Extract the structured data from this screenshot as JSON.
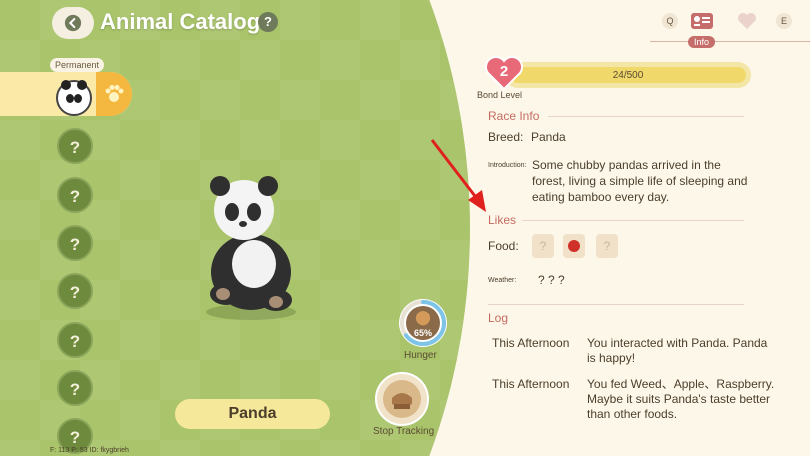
{
  "header": {
    "title": "Animal Catalog",
    "help": "?"
  },
  "sidebar": {
    "permanent_label": "Permanent",
    "slot_text": "?"
  },
  "animal": {
    "name": "Panda"
  },
  "coords": "F: 113  P: 53  ID: fkygbrieh",
  "hunger": {
    "percent": 65,
    "percent_text": "65%",
    "label": "Hunger"
  },
  "stop_tracking": {
    "label": "Stop Tracking"
  },
  "nav": {
    "q_key": "Q",
    "e_key": "E",
    "info_tab": "Info"
  },
  "bond": {
    "level": "2",
    "progress_text": "24/500",
    "progress": 0.048,
    "label": "Bond Level"
  },
  "race_info": {
    "title": "Race Info",
    "breed_label": "Breed:",
    "breed_value": "Panda",
    "intro_label": "Introduction:",
    "intro_text": "Some chubby pandas arrived in the forest, living a simple life of sleeping and eating bamboo every day."
  },
  "likes": {
    "title": "Likes",
    "food_label": "Food:",
    "food_unknown": "?",
    "weather_label": "Weather:",
    "weather_value": "? ? ?"
  },
  "log": {
    "title": "Log",
    "entries": [
      {
        "time": "This Afternoon",
        "message": "You interacted with Panda. Panda is happy!"
      },
      {
        "time": "This Afternoon",
        "message": "You fed Weed、Apple、Raspberry. Maybe it suits Panda's taste better than other foods."
      }
    ]
  },
  "colors": {
    "green_bg": "#a9c46a",
    "accent_red": "#c46b5f",
    "bond_heart": "#e86a78",
    "hunger_ring": "#7ec3e8"
  }
}
